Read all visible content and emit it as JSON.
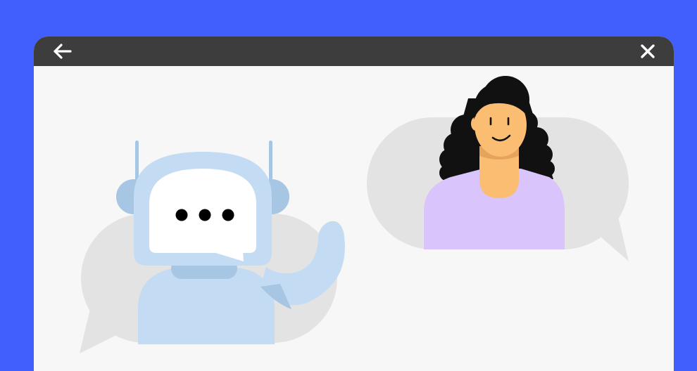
{
  "window": {
    "back_icon": "arrow-left-icon",
    "close_icon": "close-icon"
  },
  "illustration": {
    "chatbot": {
      "typing_indicator_dots": 3
    },
    "colors": {
      "background": "#405ffd",
      "titlebar": "#3d3d3d",
      "content": "#f7f7f7",
      "speech_bubble": "#e3e3e3",
      "robot_light": "#c4dbf4",
      "robot_mid": "#a6c6e3",
      "screen": "#ffffff",
      "person_shirt": "#d9c4fc",
      "person_skin": "#fbbd71",
      "person_hair": "#111111"
    }
  }
}
